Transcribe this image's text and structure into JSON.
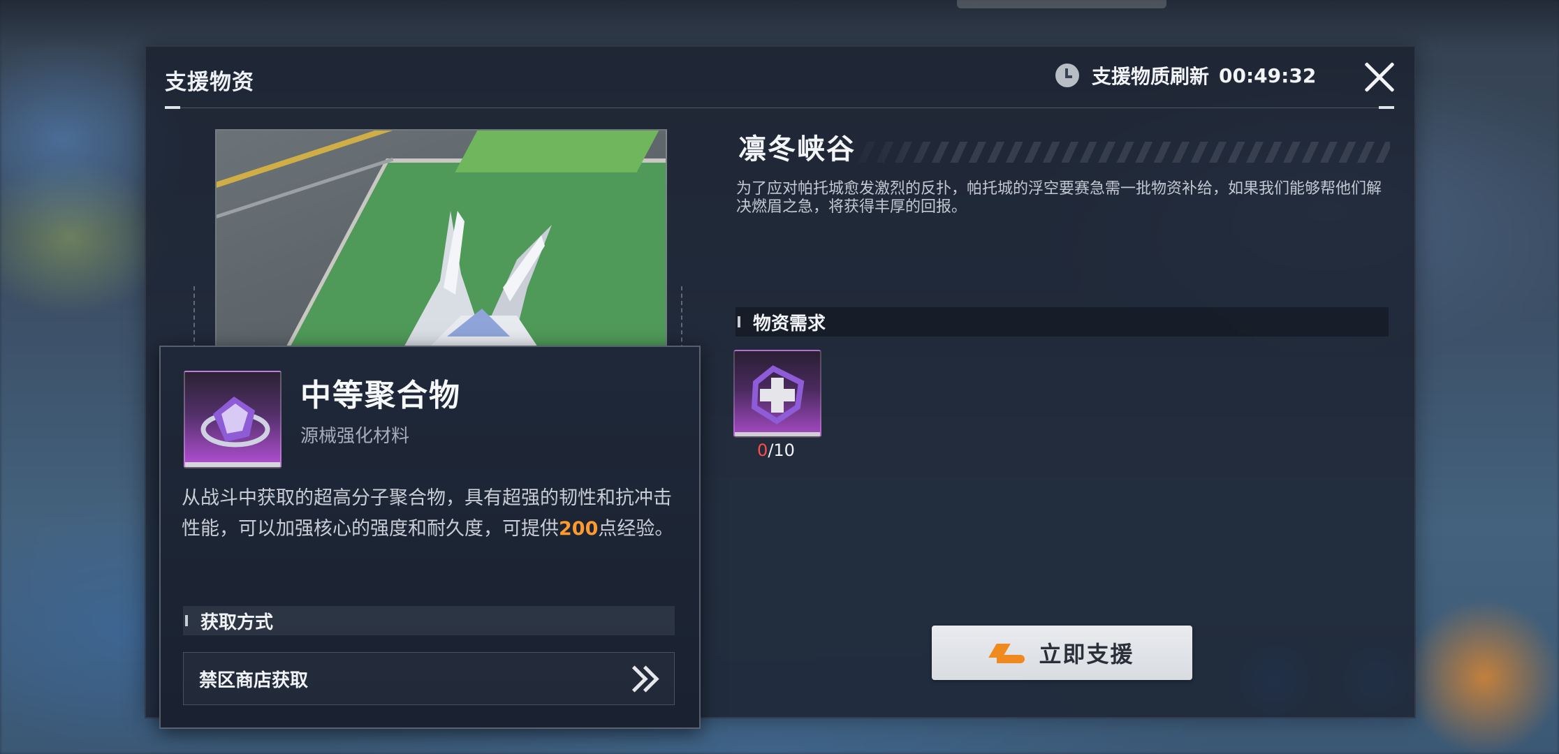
{
  "panel": {
    "title": "支援物资",
    "refresh_label": "支援物质刷新",
    "refresh_timer": "00:49:32"
  },
  "region": {
    "name": "凛冬峡谷",
    "description": "为了应对帕托城愈发激烈的反扑，帕托城的浮空要赛急需一批物资补给，如果我们能够帮他们解决燃眉之急，将获得丰厚的回报。"
  },
  "requirements": {
    "header": "物资需求",
    "items": [
      {
        "have": "0",
        "need": "/10"
      }
    ]
  },
  "support_button": {
    "label": "立即支援"
  },
  "item_card": {
    "name": "中等聚合物",
    "type": "源械强化材料",
    "desc_before": "从战斗中获取的超高分子聚合物，具有超强的韧性和抗冲击性能，可以加强核心的强度和耐久度，可提供",
    "desc_highlight": "200",
    "desc_after": "点经验。",
    "obtain_header": "获取方式",
    "obtain_source": "禁区商店获取"
  },
  "colors": {
    "accent": "#ff9a2e",
    "shortage": "#ff4d4d",
    "rarity_purple": "#b450d6"
  },
  "icons": [
    "clock-icon",
    "close-icon",
    "rocket-icon",
    "double-chevron-right-icon"
  ]
}
